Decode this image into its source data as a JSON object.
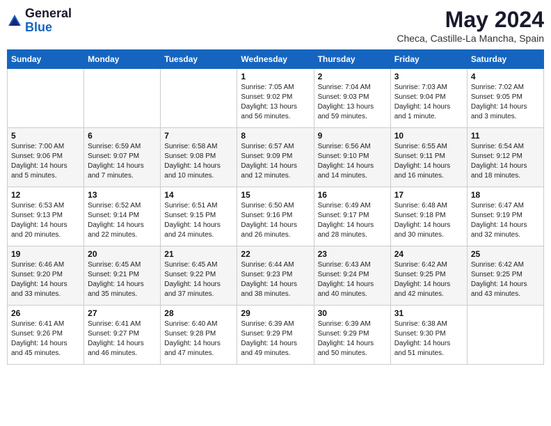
{
  "header": {
    "logo_general": "General",
    "logo_blue": "Blue",
    "month": "May 2024",
    "location": "Checa, Castille-La Mancha, Spain"
  },
  "weekdays": [
    "Sunday",
    "Monday",
    "Tuesday",
    "Wednesday",
    "Thursday",
    "Friday",
    "Saturday"
  ],
  "weeks": [
    [
      {
        "day": "",
        "info": ""
      },
      {
        "day": "",
        "info": ""
      },
      {
        "day": "",
        "info": ""
      },
      {
        "day": "1",
        "info": "Sunrise: 7:05 AM\nSunset: 9:02 PM\nDaylight: 13 hours\nand 56 minutes."
      },
      {
        "day": "2",
        "info": "Sunrise: 7:04 AM\nSunset: 9:03 PM\nDaylight: 13 hours\nand 59 minutes."
      },
      {
        "day": "3",
        "info": "Sunrise: 7:03 AM\nSunset: 9:04 PM\nDaylight: 14 hours\nand 1 minute."
      },
      {
        "day": "4",
        "info": "Sunrise: 7:02 AM\nSunset: 9:05 PM\nDaylight: 14 hours\nand 3 minutes."
      }
    ],
    [
      {
        "day": "5",
        "info": "Sunrise: 7:00 AM\nSunset: 9:06 PM\nDaylight: 14 hours\nand 5 minutes."
      },
      {
        "day": "6",
        "info": "Sunrise: 6:59 AM\nSunset: 9:07 PM\nDaylight: 14 hours\nand 7 minutes."
      },
      {
        "day": "7",
        "info": "Sunrise: 6:58 AM\nSunset: 9:08 PM\nDaylight: 14 hours\nand 10 minutes."
      },
      {
        "day": "8",
        "info": "Sunrise: 6:57 AM\nSunset: 9:09 PM\nDaylight: 14 hours\nand 12 minutes."
      },
      {
        "day": "9",
        "info": "Sunrise: 6:56 AM\nSunset: 9:10 PM\nDaylight: 14 hours\nand 14 minutes."
      },
      {
        "day": "10",
        "info": "Sunrise: 6:55 AM\nSunset: 9:11 PM\nDaylight: 14 hours\nand 16 minutes."
      },
      {
        "day": "11",
        "info": "Sunrise: 6:54 AM\nSunset: 9:12 PM\nDaylight: 14 hours\nand 18 minutes."
      }
    ],
    [
      {
        "day": "12",
        "info": "Sunrise: 6:53 AM\nSunset: 9:13 PM\nDaylight: 14 hours\nand 20 minutes."
      },
      {
        "day": "13",
        "info": "Sunrise: 6:52 AM\nSunset: 9:14 PM\nDaylight: 14 hours\nand 22 minutes."
      },
      {
        "day": "14",
        "info": "Sunrise: 6:51 AM\nSunset: 9:15 PM\nDaylight: 14 hours\nand 24 minutes."
      },
      {
        "day": "15",
        "info": "Sunrise: 6:50 AM\nSunset: 9:16 PM\nDaylight: 14 hours\nand 26 minutes."
      },
      {
        "day": "16",
        "info": "Sunrise: 6:49 AM\nSunset: 9:17 PM\nDaylight: 14 hours\nand 28 minutes."
      },
      {
        "day": "17",
        "info": "Sunrise: 6:48 AM\nSunset: 9:18 PM\nDaylight: 14 hours\nand 30 minutes."
      },
      {
        "day": "18",
        "info": "Sunrise: 6:47 AM\nSunset: 9:19 PM\nDaylight: 14 hours\nand 32 minutes."
      }
    ],
    [
      {
        "day": "19",
        "info": "Sunrise: 6:46 AM\nSunset: 9:20 PM\nDaylight: 14 hours\nand 33 minutes."
      },
      {
        "day": "20",
        "info": "Sunrise: 6:45 AM\nSunset: 9:21 PM\nDaylight: 14 hours\nand 35 minutes."
      },
      {
        "day": "21",
        "info": "Sunrise: 6:45 AM\nSunset: 9:22 PM\nDaylight: 14 hours\nand 37 minutes."
      },
      {
        "day": "22",
        "info": "Sunrise: 6:44 AM\nSunset: 9:23 PM\nDaylight: 14 hours\nand 38 minutes."
      },
      {
        "day": "23",
        "info": "Sunrise: 6:43 AM\nSunset: 9:24 PM\nDaylight: 14 hours\nand 40 minutes."
      },
      {
        "day": "24",
        "info": "Sunrise: 6:42 AM\nSunset: 9:25 PM\nDaylight: 14 hours\nand 42 minutes."
      },
      {
        "day": "25",
        "info": "Sunrise: 6:42 AM\nSunset: 9:25 PM\nDaylight: 14 hours\nand 43 minutes."
      }
    ],
    [
      {
        "day": "26",
        "info": "Sunrise: 6:41 AM\nSunset: 9:26 PM\nDaylight: 14 hours\nand 45 minutes."
      },
      {
        "day": "27",
        "info": "Sunrise: 6:41 AM\nSunset: 9:27 PM\nDaylight: 14 hours\nand 46 minutes."
      },
      {
        "day": "28",
        "info": "Sunrise: 6:40 AM\nSunset: 9:28 PM\nDaylight: 14 hours\nand 47 minutes."
      },
      {
        "day": "29",
        "info": "Sunrise: 6:39 AM\nSunset: 9:29 PM\nDaylight: 14 hours\nand 49 minutes."
      },
      {
        "day": "30",
        "info": "Sunrise: 6:39 AM\nSunset: 9:29 PM\nDaylight: 14 hours\nand 50 minutes."
      },
      {
        "day": "31",
        "info": "Sunrise: 6:38 AM\nSunset: 9:30 PM\nDaylight: 14 hours\nand 51 minutes."
      },
      {
        "day": "",
        "info": ""
      }
    ]
  ]
}
